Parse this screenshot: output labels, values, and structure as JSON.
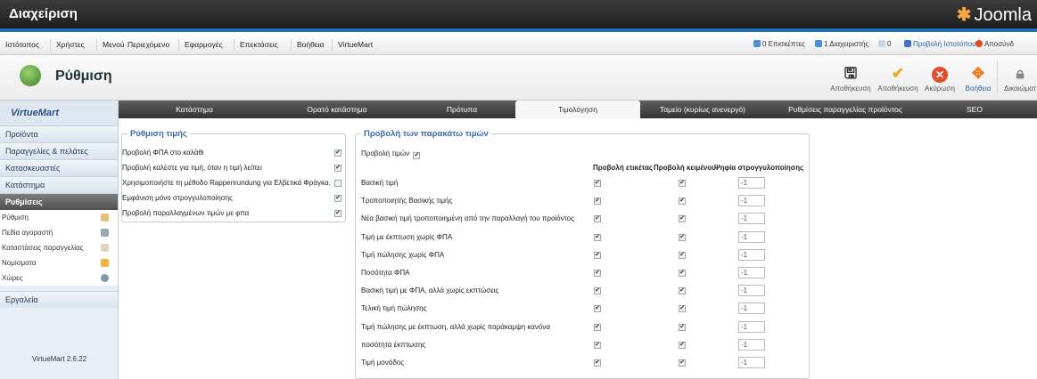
{
  "top": {
    "title": "Διαχείριση",
    "logo": "Joomla"
  },
  "menu": [
    "Ιστότοπος",
    "Χρήστες",
    "Μενού",
    "Περιεχόμενο",
    "Εφαρμογές",
    "Επεκτάσεις",
    "Βοήθεια",
    "VirtueMart"
  ],
  "status": {
    "visitors": "0 Επισκέπτες",
    "admins": "1 Διαχειριστής",
    "messages": "0",
    "view_site": "Προβολή Ιστοτόπου",
    "logout": "Αποσύνδ"
  },
  "toolbar": {
    "page_title": "Ρύθμιση",
    "buttons": [
      {
        "icon": "save-icon",
        "label": "Αποθήκευση"
      },
      {
        "icon": "save-close-icon",
        "label": "Αποθήκευση"
      },
      {
        "icon": "cancel-icon",
        "label": "Ακύρωση"
      },
      {
        "icon": "help-icon",
        "label": "Βοήθεια"
      },
      {
        "icon": "lock-icon",
        "label": "Δικαιώματ"
      }
    ]
  },
  "sidebar": {
    "logo": "VirtueMart",
    "nav": [
      "Προϊόντα",
      "Παραγγελίες & πελάτες",
      "Κατασκευαστές",
      "Κατάστημα",
      "Ρυθμίσεις"
    ],
    "sub": [
      "Ρύθμιση",
      "Πεδία αγοραστή",
      "Καταστάσεις παραγγελίας",
      "Νομίσματα",
      "Χώρες"
    ],
    "tools": "Εργαλεία",
    "version": "VirtueMart 2.6.22"
  },
  "tabs": [
    "Κατάστημα",
    "Ορατό κατάστημα",
    "Πρότυπα",
    "Τιμολόγηση",
    "Ταμείο (κυρίως ανενεργό)",
    "Ρυθμίσεις παραγγελίας προϊόντος",
    "SEO"
  ],
  "price_settings": {
    "legend": "Ρύθμιση τιμής",
    "rows": [
      {
        "label": "Προβολή ΦΠΑ στο καλάθι",
        "checked": true
      },
      {
        "label": "Προβολή καλέστε για τιμή, όταν η τιμή λείπει",
        "checked": true
      },
      {
        "label": "Χρησιμοποιήστε τη μέθοδο Rappenrundung για Ελβετικά Φράγκα.",
        "checked": false
      },
      {
        "label": "Εμφάνιση μόνο στρογγυλοποίησης",
        "checked": true
      },
      {
        "label": "Προβολή παραλλαγμένων τιμών με φπα",
        "checked": true
      }
    ]
  },
  "price_display": {
    "legend": "Προβολή των παρακάτω τιμών",
    "show_prices": "Προβολή τιμών",
    "show_prices_checked": true,
    "headers": {
      "label": "Προβολή ετικέτας",
      "text": "Προβολή κειμένου",
      "digits": "Ψηφία στρογγυλοποίησης"
    },
    "rows": [
      {
        "name": "Βασική τιμή",
        "value": "-1"
      },
      {
        "name": "Τροποποιητής Βασικής τιμής",
        "value": "-1"
      },
      {
        "name": "Νέα βασική τιμή τροποποιημένη από την παραλλαγή του προϊόντος",
        "value": "-1"
      },
      {
        "name": "Τιμή με έκπτωση χωρίς ΦΠΑ",
        "value": "-1"
      },
      {
        "name": "Τιμή πώλησης χωρίς ΦΠΑ",
        "value": "-1"
      },
      {
        "name": "Ποσότητα ΦΠΑ",
        "value": "-1"
      },
      {
        "name": "Βασική τιμή με ΦΠΑ, αλλά χωρίς εκπτώσεις",
        "value": "-1"
      },
      {
        "name": "Τελική τιμή πώλησης",
        "value": "-1"
      },
      {
        "name": "Τιμή πώλησης με έκπτωση, αλλά χωρίς παράκαμψη κανόνα",
        "value": "-1"
      },
      {
        "name": "ποσότητα έκπτωσης",
        "value": "-1"
      },
      {
        "name": "Τιμή μονάδος",
        "value": "-1"
      }
    ]
  }
}
